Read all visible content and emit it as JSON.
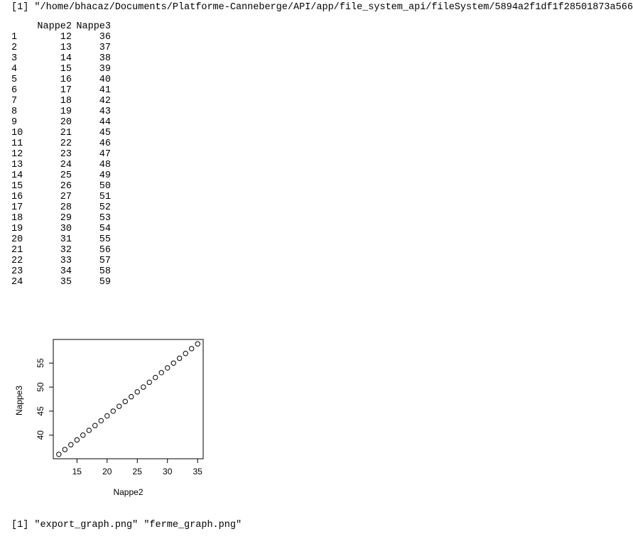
{
  "console": {
    "path_output": "[1] \"/home/bhacaz/Documents/Platforme-Canneberge/API/app/file_system_api/fileSystem/5894a2f1df1f28501873a566\"",
    "files_output": "[1] \"export_graph.png\" \"ferme_graph.png\""
  },
  "table": {
    "headers": [
      "",
      "Nappe2",
      "Nappe3"
    ],
    "rows": [
      [
        "1",
        "12",
        "36"
      ],
      [
        "2",
        "13",
        "37"
      ],
      [
        "3",
        "14",
        "38"
      ],
      [
        "4",
        "15",
        "39"
      ],
      [
        "5",
        "16",
        "40"
      ],
      [
        "6",
        "17",
        "41"
      ],
      [
        "7",
        "18",
        "42"
      ],
      [
        "8",
        "19",
        "43"
      ],
      [
        "9",
        "20",
        "44"
      ],
      [
        "10",
        "21",
        "45"
      ],
      [
        "11",
        "22",
        "46"
      ],
      [
        "12",
        "23",
        "47"
      ],
      [
        "13",
        "24",
        "48"
      ],
      [
        "14",
        "25",
        "49"
      ],
      [
        "15",
        "26",
        "50"
      ],
      [
        "16",
        "27",
        "51"
      ],
      [
        "17",
        "28",
        "52"
      ],
      [
        "18",
        "29",
        "53"
      ],
      [
        "19",
        "30",
        "54"
      ],
      [
        "20",
        "31",
        "55"
      ],
      [
        "21",
        "32",
        "56"
      ],
      [
        "22",
        "33",
        "57"
      ],
      [
        "23",
        "34",
        "58"
      ],
      [
        "24",
        "35",
        "59"
      ]
    ]
  },
  "chart_data": {
    "type": "scatter",
    "xlabel": "Nappe2",
    "ylabel": "Nappe3",
    "xlim": [
      11.08,
      35.92
    ],
    "ylim": [
      35.08,
      59.92
    ],
    "xticks": [
      15,
      20,
      25,
      30,
      35
    ],
    "yticks": [
      40,
      45,
      50,
      55
    ],
    "marker": "open-circle",
    "grid": false,
    "x": [
      12,
      13,
      14,
      15,
      16,
      17,
      18,
      19,
      20,
      21,
      22,
      23,
      24,
      25,
      26,
      27,
      28,
      29,
      30,
      31,
      32,
      33,
      34,
      35
    ],
    "y": [
      36,
      37,
      38,
      39,
      40,
      41,
      42,
      43,
      44,
      45,
      46,
      47,
      48,
      49,
      50,
      51,
      52,
      53,
      54,
      55,
      56,
      57,
      58,
      59
    ]
  }
}
